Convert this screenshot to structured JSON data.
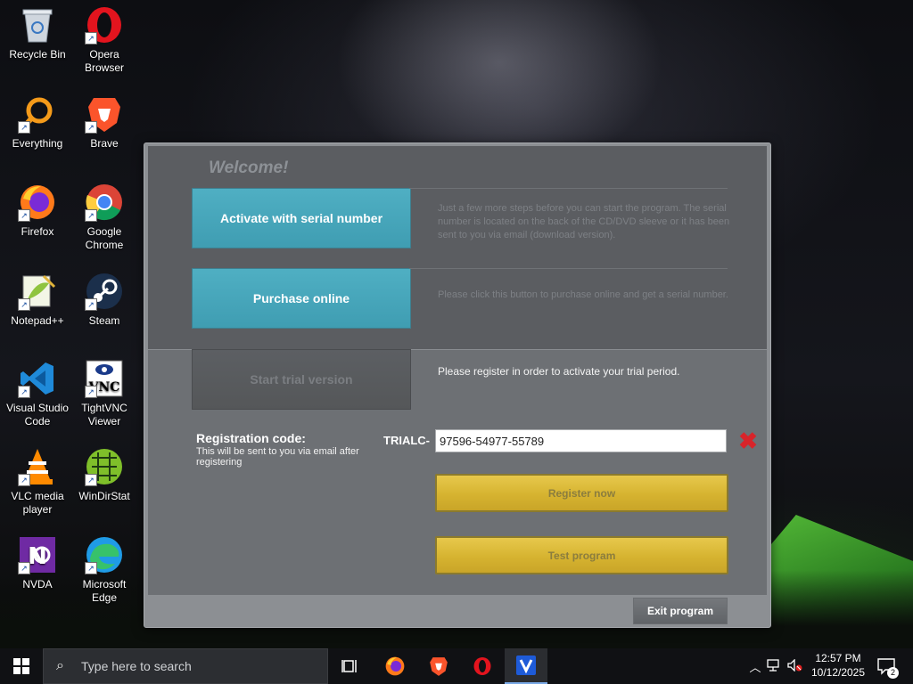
{
  "desktop": {
    "icons": [
      {
        "label": "Recycle Bin",
        "icon": "recycle-bin-icon"
      },
      {
        "label": "Opera\nBrowser",
        "icon": "opera-icon"
      },
      {
        "label": "Everything",
        "icon": "everything-search-icon"
      },
      {
        "label": "Brave",
        "icon": "brave-icon"
      },
      {
        "label": "Firefox",
        "icon": "firefox-icon"
      },
      {
        "label": "Google\nChrome",
        "icon": "chrome-icon"
      },
      {
        "label": "Notepad++",
        "icon": "notepadpp-icon"
      },
      {
        "label": "Steam",
        "icon": "steam-icon"
      },
      {
        "label": "Visual Studio\nCode",
        "icon": "vscode-icon"
      },
      {
        "label": "TightVNC\nViewer",
        "icon": "tightvnc-icon"
      },
      {
        "label": "VLC media\nplayer",
        "icon": "vlc-icon"
      },
      {
        "label": "WinDirStat",
        "icon": "windirstat-icon"
      },
      {
        "label": "NVDA",
        "icon": "nvda-icon"
      },
      {
        "label": "Microsoft\nEdge",
        "icon": "edge-icon"
      }
    ]
  },
  "dialog": {
    "welcome": "Welcome!",
    "activate_label": "Activate with serial number",
    "activate_desc": "Just a few more steps before you can start the program. The serial number is located on the back of the CD/DVD sleeve or it has been sent to you via email (download version).",
    "purchase_label": "Purchase online",
    "purchase_desc": "Please click this button to purchase online and get a serial number.",
    "trial_label": "Start trial version",
    "trial_desc": "Please register in order to activate your trial period.",
    "reg_label": "Registration code:",
    "reg_sub": "This will be sent to you via email after registering",
    "code_prefix": "TRIALC-",
    "code_value": "97596-54977-55789",
    "clear_glyph": "✖",
    "register_label": "Register now",
    "test_label": "Test program",
    "exit_label": "Exit program"
  },
  "taskbar": {
    "search_placeholder": "Type here to search",
    "time": "12:57 PM",
    "date": "10/12/2025",
    "notification_count": "2",
    "apps": [
      "task-view",
      "firefox",
      "brave",
      "opera",
      "vivaldi"
    ]
  },
  "colors": {
    "teal": "#45a6ba",
    "gold": "#d6b330",
    "close_red": "#d8242a",
    "dialog_bg": "#6d7074"
  }
}
